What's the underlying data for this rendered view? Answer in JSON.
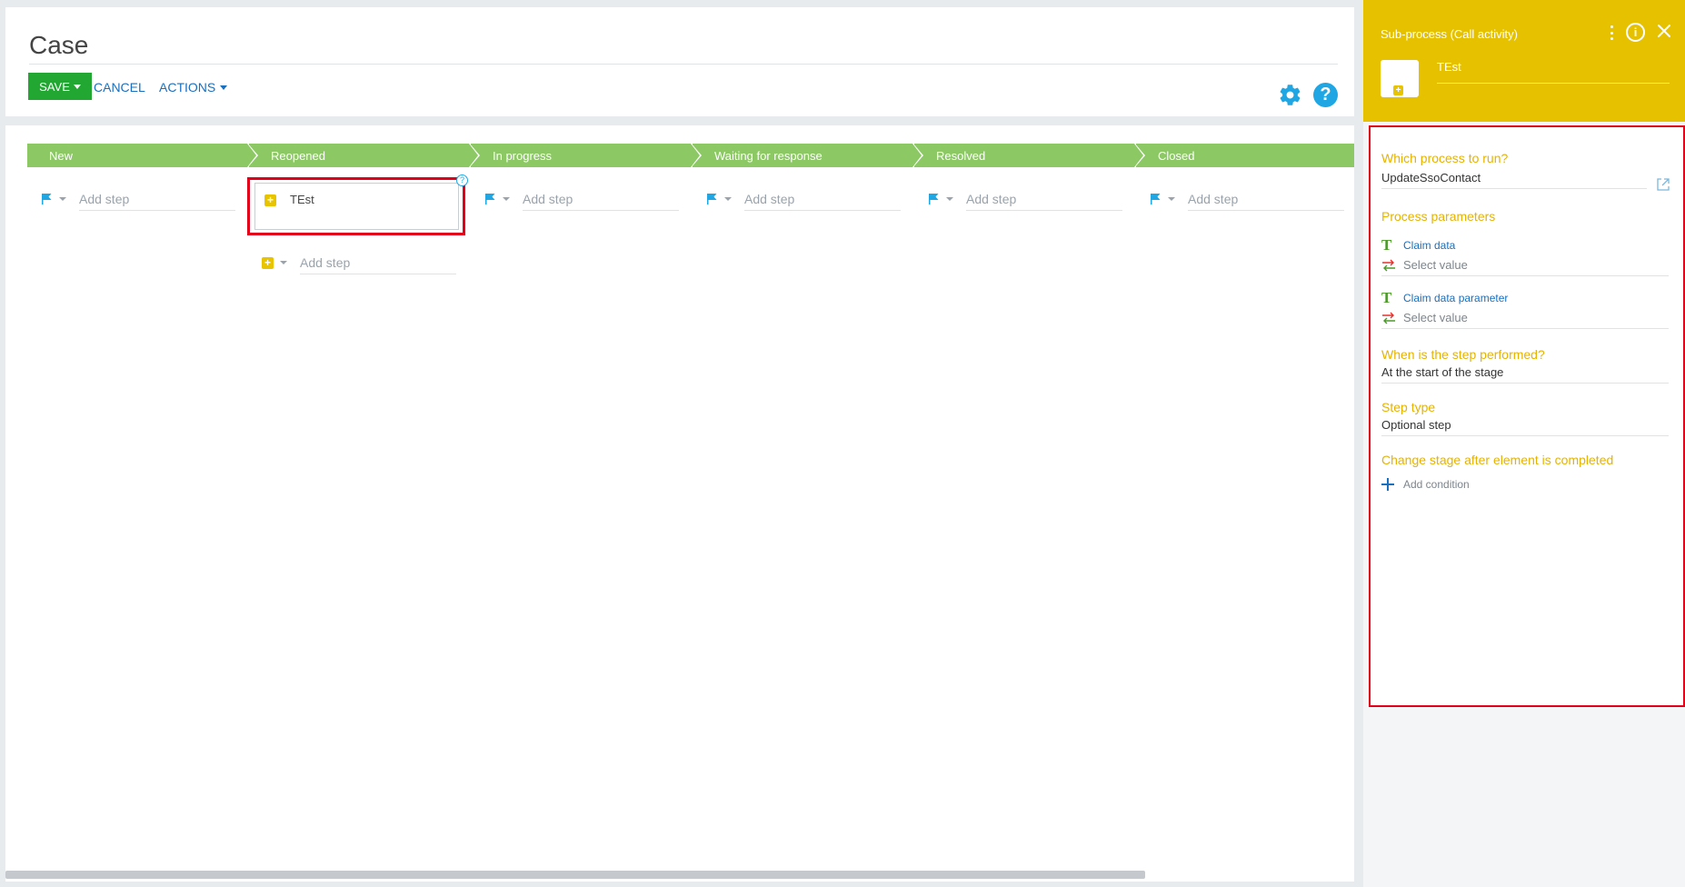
{
  "header": {
    "title": "Case",
    "save_label": "SAVE",
    "cancel_label": "CANCEL",
    "actions_label": "ACTIONS",
    "help_symbol": "?"
  },
  "stages": [
    {
      "label": "New"
    },
    {
      "label": "Reopened"
    },
    {
      "label": "In progress"
    },
    {
      "label": "Waiting for response"
    },
    {
      "label": "Resolved"
    },
    {
      "label": "Closed"
    }
  ],
  "add_step_label": "Add step",
  "element": {
    "name": "TEst",
    "info_symbol": "?"
  },
  "panel": {
    "title": "Sub-process (Call activity)",
    "name_value": "TEst",
    "info_symbol": "i",
    "process_section": "Which process to run?",
    "process_value": "UpdateSsoContact",
    "params_section": "Process parameters",
    "params": [
      {
        "name": "Claim data",
        "value_placeholder": "Select value"
      },
      {
        "name": "Claim data parameter",
        "value_placeholder": "Select value"
      }
    ],
    "when_section": "When is the step performed?",
    "when_value": "At the start of the stage",
    "type_section": "Step type",
    "type_value": "Optional step",
    "change_section": "Change stage after element is completed",
    "add_condition_label": "Add condition",
    "param_type_symbol": "T"
  },
  "colors": {
    "accent_green": "#21a732",
    "stage_green": "#8cc864",
    "panel_yellow": "#e5c100",
    "highlight_red": "#e3001b",
    "link_blue": "#1a6fbf",
    "flag_blue": "#1fa6e3"
  }
}
